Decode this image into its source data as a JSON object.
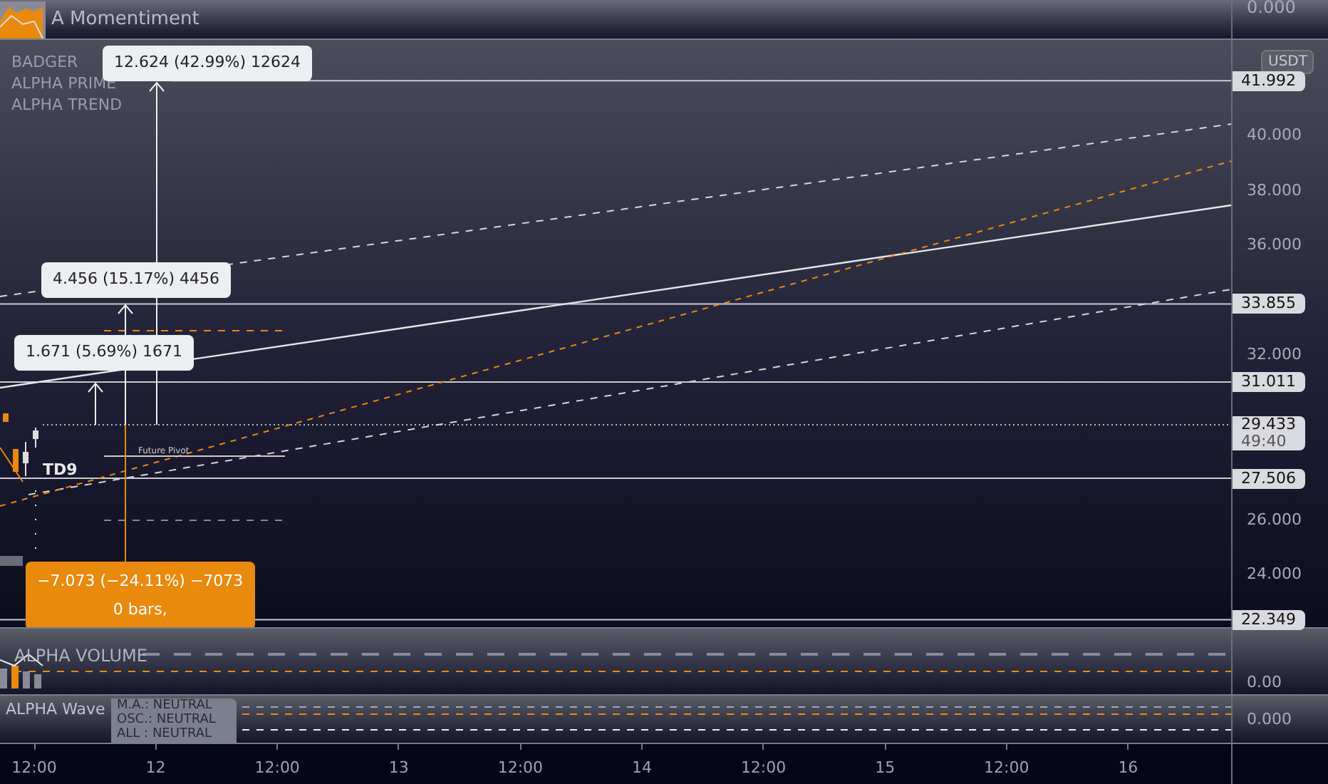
{
  "momentum_pane": {
    "title": "A Momentiment",
    "axis_label": "0.000"
  },
  "legend": [
    "BADGER",
    "ALPHA PRIME",
    "ALPHA TREND"
  ],
  "currency": "USDT",
  "price_ticks": [
    "40.000",
    "38.000",
    "36.000",
    "32.000",
    "26.000",
    "24.000"
  ],
  "price_labels": [
    "41.992",
    "33.855",
    "31.011",
    "27.506",
    "22.349"
  ],
  "current_price": {
    "label": "29.433",
    "countdown": "49:40"
  },
  "callouts": [
    {
      "kind": "gain",
      "text": "12.624 (42.99%) 12624"
    },
    {
      "kind": "gain",
      "text": "4.456 (15.17%) 4456"
    },
    {
      "kind": "gain",
      "text": "1.671 (5.69%) 1671"
    },
    {
      "kind": "loss",
      "text": "−7.073 (−24.11%) −7073",
      "sub": "0 bars,"
    }
  ],
  "td_label": "TD9",
  "pivot_label": "Future Pivot",
  "volume_pane": {
    "title": "ALPHA VOLUME",
    "axis_label": "0.00"
  },
  "wave_pane": {
    "title": "ALPHA Wave",
    "status": [
      "M.A.: NEUTRAL",
      "OSC.: NEUTRAL",
      "ALL : NEUTRAL"
    ],
    "axis_label": "0.000"
  },
  "time_axis": [
    "12:00",
    "12",
    "12:00",
    "13",
    "12:00",
    "14",
    "12:00",
    "15",
    "12:00",
    "16"
  ]
}
